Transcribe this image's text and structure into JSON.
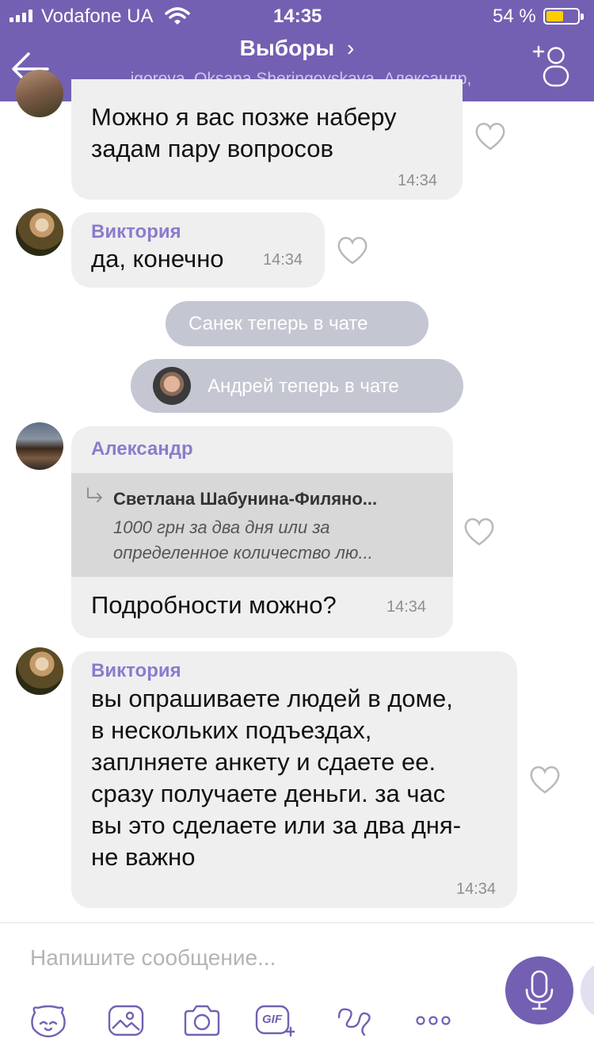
{
  "status_bar": {
    "carrier": "Vodafone UA",
    "time": "14:35",
    "battery_percent": "54 %",
    "battery_level": 0.54
  },
  "header": {
    "title": "Выборы",
    "title_chevron": "›",
    "participants": "igoreva, Oksana Sheringovskaya, Александр,",
    "back_icon": "back-arrow-icon",
    "add_icon": "add-participant-icon"
  },
  "messages": [
    {
      "text": "Можно я вас позже наберу\nзадам пару вопросов",
      "time": "14:34"
    },
    {
      "sender": "Виктория",
      "text": "да, конечно",
      "time": "14:34"
    },
    {
      "system": "Санек теперь в чате"
    },
    {
      "system": "Андрей теперь в чате"
    },
    {
      "sender": "Александр",
      "quote_author": "Светлана Шабунина-Филяно...",
      "quote_text": "1000 грн за два дня или за\nопределенное количество лю...",
      "text": "Подробности можно?",
      "time": "14:34"
    },
    {
      "sender": "Виктория",
      "text": "вы опрашиваете людей в доме,\nв нескольких подъездах,\nзаплняете анкету и сдаете ее.\nсразу получаете деньги. за час\nвы это сделаете или за два дня-\nне важно",
      "time": "14:34"
    }
  ],
  "composer": {
    "placeholder": "Напишите сообщение...",
    "toolbar": [
      "sticker-icon",
      "gallery-icon",
      "camera-icon",
      "gif-icon",
      "doodle-icon",
      "more-icon"
    ],
    "gif_label": "GIF"
  },
  "colors": {
    "brand": "#7360b2",
    "bubble": "#efefef",
    "sender": "#8c7bcd",
    "system_pill": "#c4c7d2"
  }
}
